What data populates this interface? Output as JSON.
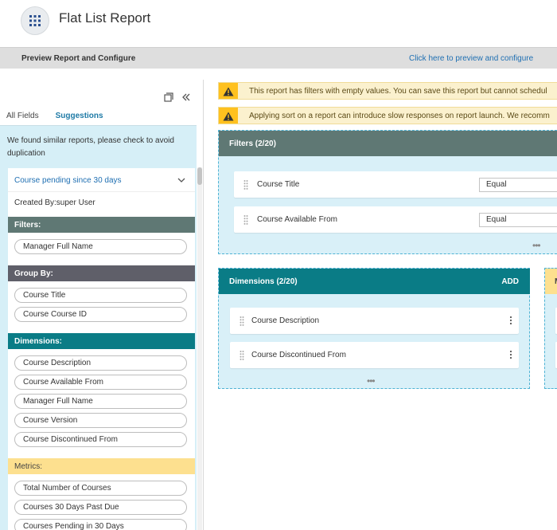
{
  "header": {
    "title": "Flat List Report",
    "icon": "grid-icon"
  },
  "preview_bar": {
    "label": "Preview Report and Configure",
    "link": "Click here to preview and configure"
  },
  "left_panel": {
    "tabs": [
      {
        "label": "All Fields"
      },
      {
        "label": "Suggestions",
        "active": true
      }
    ],
    "note": "We found similar reports, please check to avoid duplication",
    "card": {
      "title": "Course pending since 30 days",
      "created_by": "Created By:super User",
      "sections": {
        "filters": {
          "label": "Filters:",
          "items": [
            "Manager Full Name"
          ]
        },
        "group_by": {
          "label": "Group By:",
          "items": [
            "Course Title",
            "Course Course ID"
          ]
        },
        "dimensions": {
          "label": "Dimensions:",
          "items": [
            "Course Description",
            "Course Available From",
            "Manager Full Name",
            "Course Version",
            "Course Discontinued From"
          ]
        },
        "metrics": {
          "label": "Metrics:",
          "items": [
            "Total Number of Courses",
            "Courses 30 Days Past Due",
            "Courses Pending in 30 Days"
          ]
        }
      }
    }
  },
  "warnings": [
    "This report has filters with empty values. You can save this report but cannot schedul",
    "Applying sort on a report can introduce slow responses on report launch. We recomm"
  ],
  "filters_box": {
    "title": "Filters (2/20)",
    "rows": [
      {
        "label": "Course Title",
        "operator": "Equal"
      },
      {
        "label": "Course Available From",
        "operator": "Equal"
      }
    ],
    "more": "•••"
  },
  "dimensions_box": {
    "title": "Dimensions (2/20)",
    "add_label": "ADD",
    "rows": [
      {
        "label": "Course Description"
      },
      {
        "label": "Course Discontinued From"
      }
    ],
    "more": "•••"
  },
  "metrics_box": {
    "title_initial": "M"
  },
  "colors": {
    "filters_header": "#5f7874",
    "dimensions_header": "#0a7c86",
    "metrics_header": "#fde08f",
    "group_header": "#5f5f69",
    "link": "#1f6fb2",
    "warning": "#ffc11f",
    "box_bg": "#d9f0f8"
  }
}
